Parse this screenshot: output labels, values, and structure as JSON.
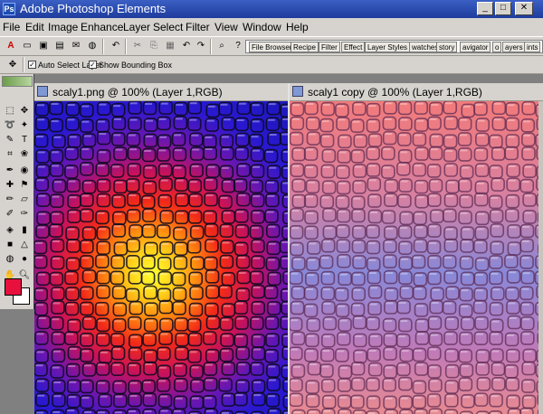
{
  "window": {
    "title": "Adobe Photoshop Elements",
    "icon": "ps-elements-icon",
    "controls": {
      "minimize": "_",
      "maximize": "□",
      "close": "✕"
    }
  },
  "menu": [
    "File",
    "Edit",
    "Image",
    "Enhance",
    "Layer",
    "Select",
    "Filter",
    "View",
    "Window",
    "Help"
  ],
  "palette_well": {
    "tabs": [
      "File Browser",
      "Recipe",
      "Filter",
      "Effect",
      "Layer Styles",
      "watches",
      "story",
      "avigator",
      "o",
      "ayers",
      "ints"
    ]
  },
  "options": {
    "auto_select_layer": {
      "label": "Auto Select Layer",
      "checked": true
    },
    "show_bounding_box": {
      "label": "Show Bounding Box",
      "checked": true
    }
  },
  "documents": [
    {
      "title": "scaly1.png @ 100% (Layer 1,RGB)"
    },
    {
      "title": "scaly1 copy @ 100% (Layer 1,RGB)"
    }
  ],
  "colors": {
    "foreground": "#e8103c",
    "background": "#ffffff",
    "titlebar": "#1e3c9c",
    "chrome": "#d6d3ce"
  }
}
